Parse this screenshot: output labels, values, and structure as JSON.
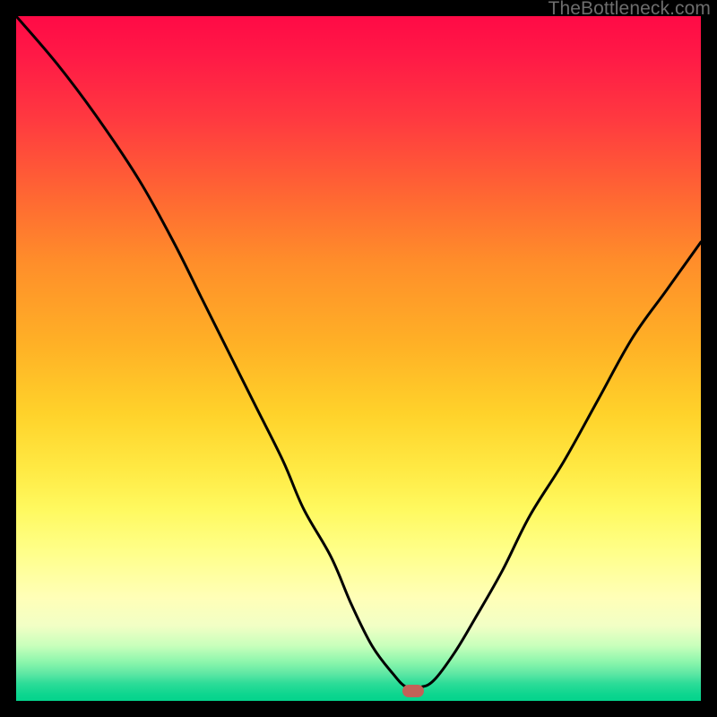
{
  "watermark": "TheBottleneck.com",
  "chart_data": {
    "type": "line",
    "title": "",
    "xlabel": "",
    "ylabel": "",
    "xlim": [
      0,
      100
    ],
    "ylim": [
      0,
      100
    ],
    "comment": "Y-values are the vertical position of the black curve read from the plot, where 0 = bottom edge and 100 = top edge. Curve descends from top-left, flattens to a minimum near x≈58, then rises toward the right.",
    "x": [
      0,
      6,
      12,
      18,
      23,
      27,
      31,
      35,
      39,
      42,
      46,
      49,
      52,
      55,
      57,
      59,
      61,
      64,
      67,
      71,
      75,
      80,
      85,
      90,
      95,
      100
    ],
    "values": [
      100,
      93,
      85,
      76,
      67,
      59,
      51,
      43,
      35,
      28,
      21,
      14,
      8,
      4,
      2,
      2,
      3,
      7,
      12,
      19,
      27,
      35,
      44,
      53,
      60,
      67
    ],
    "minimum_marker": {
      "x": 58,
      "y": 1.5
    },
    "gradient_stops": [
      {
        "pos": 0,
        "color": "#ff0a46"
      },
      {
        "pos": 0.5,
        "color": "#ffc028"
      },
      {
        "pos": 0.78,
        "color": "#ffff88"
      },
      {
        "pos": 1.0,
        "color": "#04d38c"
      }
    ]
  }
}
